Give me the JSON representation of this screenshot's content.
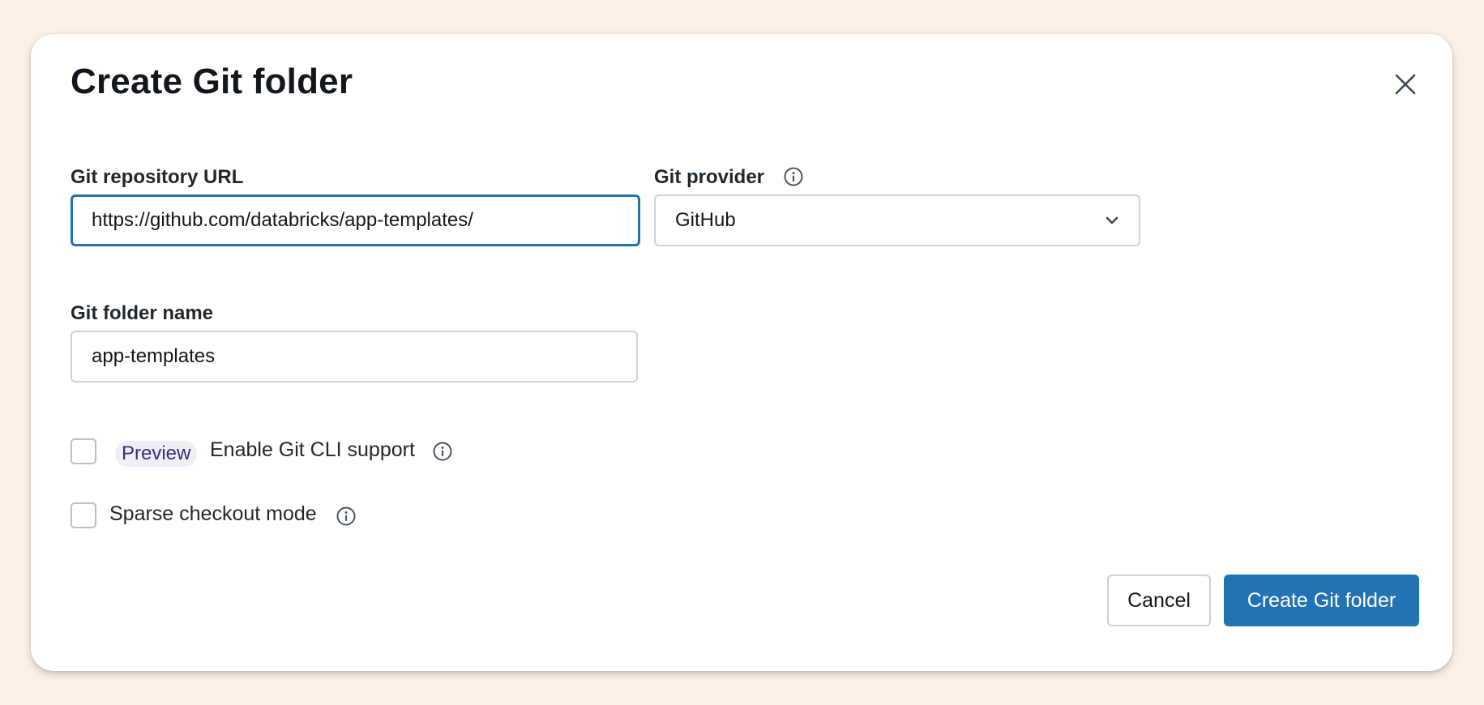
{
  "dialog": {
    "title": "Create Git folder",
    "close_icon": "close-icon"
  },
  "fields": {
    "repo_url": {
      "label": "Git repository URL",
      "value": "https://github.com/databricks/app-templates/"
    },
    "provider": {
      "label": "Git provider",
      "info_icon": "info-icon",
      "selected": "GitHub",
      "chevron_icon": "chevron-down-icon"
    },
    "folder_name": {
      "label": "Git folder name",
      "value": "app-templates"
    }
  },
  "options": {
    "git_cli": {
      "badge": "Preview",
      "label": "Enable Git CLI support",
      "checked": false
    },
    "sparse_checkout": {
      "label": "Sparse checkout mode",
      "checked": false
    }
  },
  "footer": {
    "cancel_label": "Cancel",
    "create_label": "Create Git folder"
  },
  "colors": {
    "accent": "#2272b4",
    "background": "#fdf0e7",
    "badge_bg": "#f1eef8",
    "badge_text": "#3c2e78"
  }
}
